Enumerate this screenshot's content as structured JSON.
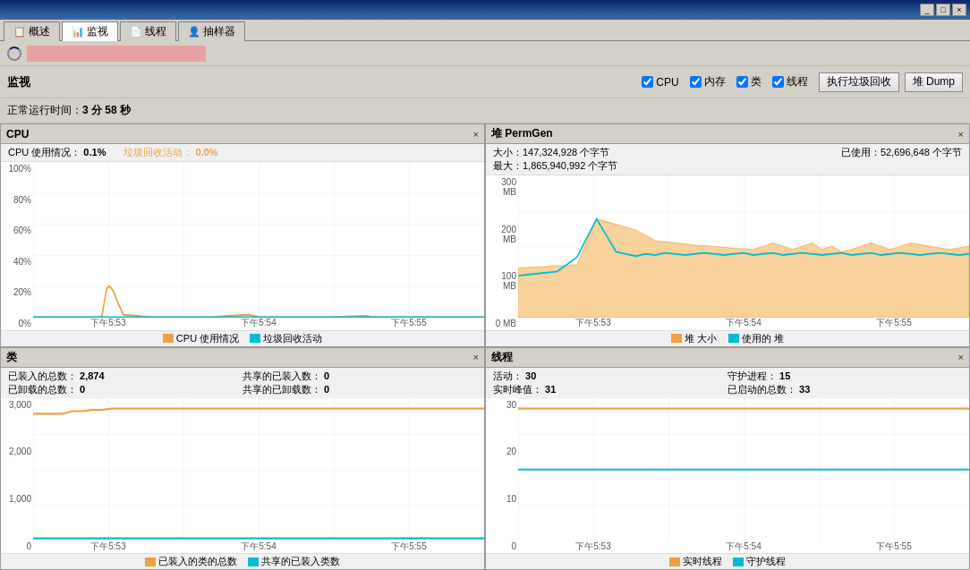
{
  "titlebar": {
    "buttons": [
      "_",
      "□",
      "×"
    ]
  },
  "tabs": [
    {
      "label": "概述",
      "icon": "📋",
      "active": false
    },
    {
      "label": "监视",
      "icon": "📊",
      "active": true
    },
    {
      "label": "线程",
      "icon": "📄",
      "active": false
    },
    {
      "label": "抽样器",
      "icon": "👤",
      "active": false
    }
  ],
  "topbar": {
    "spinner": true
  },
  "toolbar": {
    "label": "监视",
    "checkboxes": [
      {
        "label": "CPU",
        "checked": true
      },
      {
        "label": "内存",
        "checked": true
      },
      {
        "label": "类",
        "checked": true
      },
      {
        "label": "线程",
        "checked": true
      }
    ],
    "buttons": [
      {
        "label": "执行垃圾回收"
      },
      {
        "label": "堆 Dump"
      }
    ]
  },
  "uptime": {
    "prefix": "正常运行时间：",
    "value": "3 分 58 秒"
  },
  "cpu_panel": {
    "title": "CPU",
    "stats": [
      {
        "label": "CPU 使用情况：",
        "value": "0.1%"
      },
      {
        "label": "垃圾回收活动：",
        "value": "0.0%",
        "color": "#f0a040"
      }
    ],
    "y_labels": [
      "100%",
      "80%",
      "60%",
      "40%",
      "20%",
      "0%"
    ],
    "x_labels": [
      "下午5:53",
      "下午5:54",
      "下午5:55"
    ],
    "legend": [
      {
        "label": "CPU 使用情况",
        "color": "#f0a040"
      },
      {
        "label": "垃圾回收活动",
        "color": "#00bcd4"
      }
    ],
    "cpu_data": [
      0,
      0,
      0,
      0,
      0,
      0,
      0,
      0,
      0,
      0,
      18,
      16,
      10,
      2,
      1,
      0,
      0,
      0,
      0,
      0,
      0,
      0,
      0,
      0,
      0,
      0,
      0,
      0,
      1,
      0,
      0,
      0,
      0,
      0,
      0,
      0,
      0,
      0,
      0,
      0,
      0,
      1,
      0,
      0,
      0,
      0,
      0,
      0,
      0,
      0,
      0,
      0,
      0,
      0,
      0,
      0,
      0,
      0,
      0,
      0
    ],
    "gc_data": [
      0,
      0,
      0,
      0,
      0,
      0,
      0,
      0,
      0,
      0,
      0,
      0,
      0,
      0,
      0,
      0,
      0,
      0,
      0,
      0,
      0,
      0,
      0,
      0,
      0,
      0,
      0,
      0,
      0,
      0,
      0,
      0,
      0,
      0,
      0,
      0,
      0,
      0,
      0,
      0,
      0,
      0,
      0,
      0,
      0,
      0,
      0,
      0,
      0,
      0,
      0,
      0,
      0,
      0,
      0,
      0,
      0,
      0,
      0,
      0
    ]
  },
  "heap_panel": {
    "title": "堆  PermGen",
    "stats_line1": "大小：147,324,928 个字节",
    "stats_line2": "最大：1,865,940,992 个字节",
    "stats_right": "已使用：52,696,648 个字节",
    "y_labels": [
      "300 MB",
      "200 MB",
      "100 MB",
      "0 MB"
    ],
    "x_labels": [
      "下午5:53",
      "下午5:54",
      "下午5:55"
    ],
    "legend": [
      {
        "label": "堆 大小",
        "color": "#f0a040"
      },
      {
        "label": "使用的 堆",
        "color": "#00bcd4"
      }
    ]
  },
  "classes_panel": {
    "title": "类",
    "stats": [
      {
        "label": "已装入的总数：",
        "value": "2,874"
      },
      {
        "label": "已卸载的总数：",
        "value": "0"
      },
      {
        "label": "共享的已装入数：",
        "value": "0"
      },
      {
        "label": "共享的已卸载数：",
        "value": "0"
      }
    ],
    "y_labels": [
      "3,000",
      "2,000",
      "1,000",
      "0"
    ],
    "x_labels": [
      "下午5:53",
      "下午5:54",
      "下午5:55"
    ],
    "legend": [
      {
        "label": "已装入的类的总数",
        "color": "#f0a040"
      },
      {
        "label": "共享的已装入类数",
        "color": "#00bcd4"
      }
    ]
  },
  "threads_panel": {
    "title": "线程",
    "stats": [
      {
        "label": "活动：",
        "value": "30"
      },
      {
        "label": "实时峰值：",
        "value": "31"
      },
      {
        "label": "守护进程：",
        "value": "15"
      },
      {
        "label": "已启动的总数：",
        "value": "33"
      }
    ],
    "y_labels": [
      "30",
      "20",
      "10",
      "0"
    ],
    "x_labels": [
      "下午5:53",
      "下午5:54",
      "下午5:55"
    ],
    "legend": [
      {
        "label": "实时线程",
        "color": "#f0a040"
      },
      {
        "label": "守护线程",
        "color": "#00bcd4"
      }
    ]
  }
}
